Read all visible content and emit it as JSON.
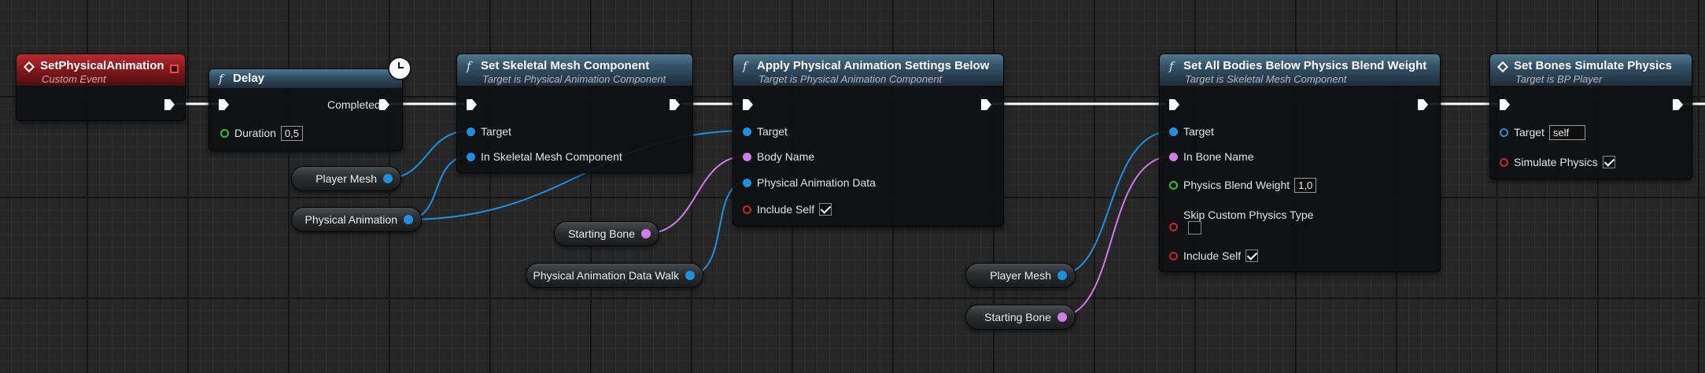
{
  "nodes": {
    "custom_event": {
      "title": "SetPhysicalAnimation",
      "subtitle": "Custom Event"
    },
    "delay": {
      "title": "Delay",
      "completed_label": "Completed",
      "duration_label": "Duration",
      "duration_value": "0,5"
    },
    "set_skel": {
      "title": "Set Skeletal Mesh Component",
      "subtitle": "Target is Physical Animation Component",
      "pin_target": "Target",
      "pin_in_skel": "In Skeletal Mesh Component"
    },
    "apply_anim": {
      "title": "Apply Physical Animation Settings Below",
      "subtitle": "Target is Physical Animation Component",
      "pin_target": "Target",
      "pin_body_name": "Body Name",
      "pin_pa_data": "Physical Animation Data",
      "pin_include_self": "Include Self",
      "include_self_checked": true
    },
    "blend": {
      "title": "Set All Bodies Below Physics Blend Weight",
      "subtitle": "Target is Skeletal Mesh Component",
      "pin_target": "Target",
      "pin_bone": "In Bone Name",
      "pin_weight": "Physics Blend Weight",
      "weight_value": "1,0",
      "pin_skip": "Skip Custom Physics Type",
      "skip_checked": false,
      "pin_include_self": "Include Self",
      "include_self_checked": true
    },
    "bones_sim": {
      "title": "Set Bones Simulate Physics",
      "subtitle": "Target is BP Player",
      "pin_target": "Target",
      "target_value": "self",
      "pin_simulate": "Simulate Physics",
      "simulate_checked": true
    }
  },
  "variables": {
    "player_mesh_1": "Player Mesh",
    "physical_animation": "Physical Animation",
    "starting_bone_1": "Starting Bone",
    "pa_data_walk": "Physical Animation Data Walk",
    "player_mesh_2": "Player Mesh",
    "starting_bone_2": "Starting Bone"
  },
  "colors": {
    "exec_wire": "#ffffff",
    "object_pin": "#1d90e0",
    "name_pin": "#cf7de8",
    "bool_pin": "#c22a2a",
    "float_pin": "#27c43a",
    "event_header": "#8c1a1d",
    "function_header": "#35546a"
  }
}
